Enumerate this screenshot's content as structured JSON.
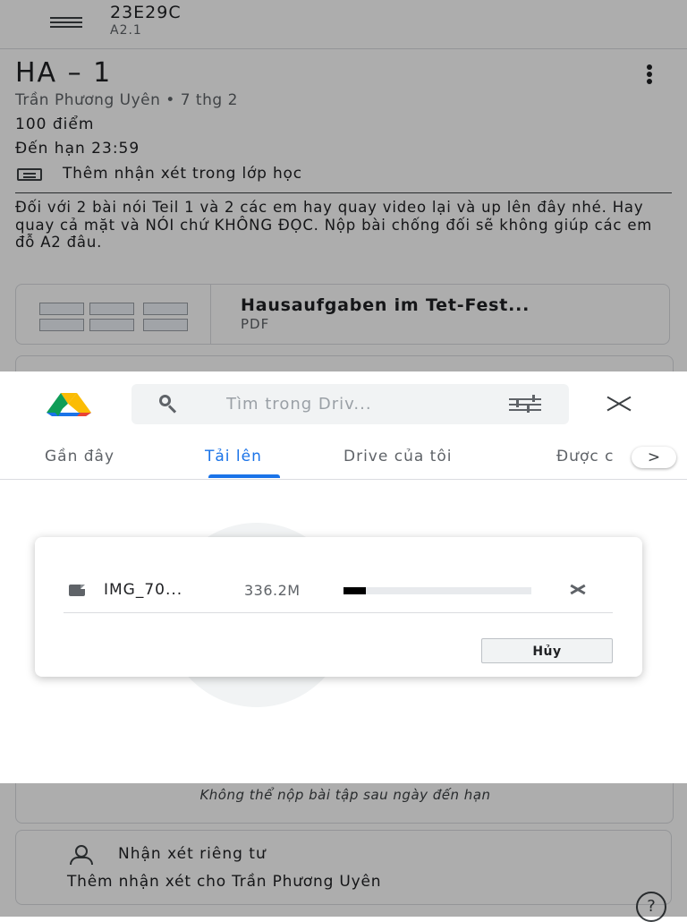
{
  "app_bar": {
    "class_name": "23E29C",
    "class_section": "A2.1"
  },
  "assignment": {
    "title": "HA – 1",
    "meta": "Trần Phương Uyên • 7 thg 2",
    "points": "100 điểm",
    "due": "Đến hạn 23:59",
    "class_comment_label": "Thêm nhận xét trong lớp học",
    "description": "Đối với 2 bài nói Teil 1 và 2 các em hay quay video lại và up lên đây nhé. Hay quay cả mặt và NÓI chứ KHÔNG ĐỌC. Nộp bài chống đối sẽ không giúp các em đỗ A2 đâu.",
    "attachment": {
      "name": "Hausaufgaben im Tet-Fest...",
      "type": "PDF"
    },
    "work_note": "Không thể nộp bài tập sau ngày đến hạn",
    "private_comments": {
      "title": "Nhận xét riêng tư",
      "add_label": "Thêm nhận xét cho Trần Phương Uyên"
    }
  },
  "drive_picker": {
    "search_placeholder": "Tìm trong Driv...",
    "tabs": [
      {
        "label": "Gần đây",
        "active": false
      },
      {
        "label": "Tải lên",
        "active": true
      },
      {
        "label": "Drive của tôi",
        "active": false
      },
      {
        "label": "Được c",
        "active": false
      }
    ],
    "next_tab_glyph": ">",
    "upload": {
      "file_name": "IMG_70...",
      "file_size": "336.2M",
      "progress_fraction": 0.12,
      "cancel_button_label": "Hủy"
    }
  },
  "icons": {
    "menu": "menu-icon",
    "more": "more-vert-icon",
    "comment": "comment-icon",
    "drive": "google-drive-logo",
    "search": "search-icon",
    "filter": "filter-icon",
    "close": "close-icon",
    "file": "file-icon",
    "cancel": "cancel-upload-icon",
    "person": "person-icon",
    "help": "help-icon"
  },
  "colors": {
    "accent": "#1a73e8",
    "scrim": "rgba(0,0,0,0.32)",
    "progress_fill": "#000000",
    "progress_track": "#e8eaed"
  }
}
